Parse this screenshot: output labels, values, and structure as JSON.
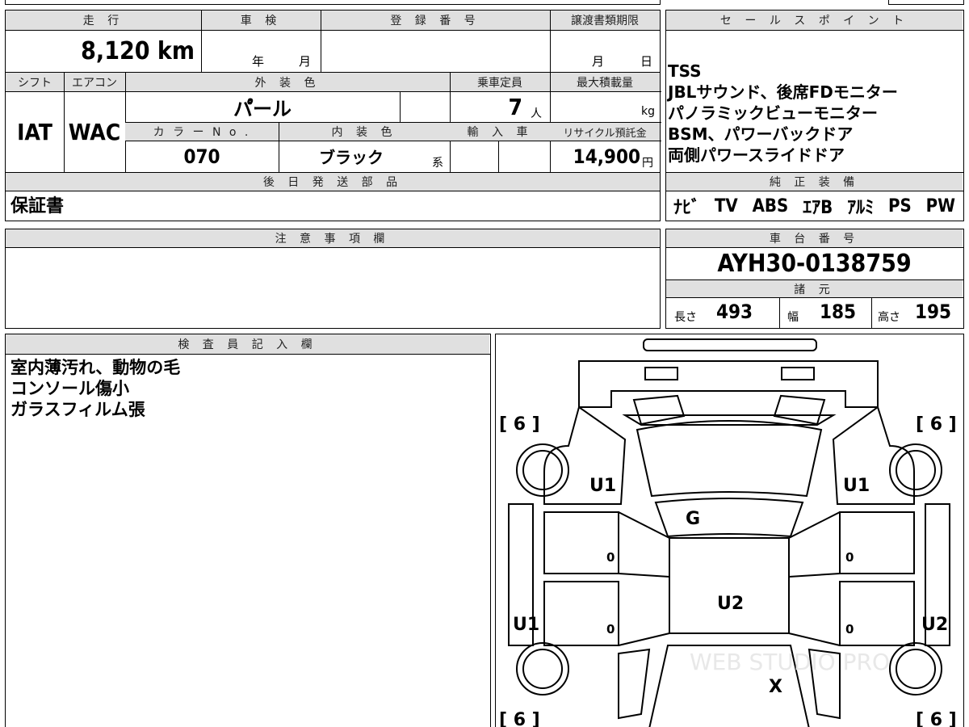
{
  "top_sheet": {
    "mileage_label": "走 行",
    "mileage_value": "8,120 km",
    "inspection_label": "車 検",
    "inspection_year_unit": "年",
    "inspection_month_unit": "月",
    "registration_label": "登 録 番 号",
    "registration_value": "",
    "transfer_deadline_label": "譲渡書類期限",
    "transfer_month_unit": "月",
    "transfer_day_unit": "日",
    "shift_label": "シフト",
    "shift_value": "IAT",
    "aircon_label": "エアコン",
    "aircon_value": "WAC",
    "exterior_color_label": "外 装 色",
    "exterior_color_value": "パ゚ール",
    "capacity_label": "乗車定員",
    "capacity_value": "7",
    "capacity_unit": "人",
    "max_load_label": "最大積載量",
    "max_load_unit": "kg",
    "color_no_label": "カ ラ ー N o .",
    "color_no_value": "070",
    "interior_color_label": "内 装 色",
    "interior_color_value": "ブラック",
    "interior_color_suffix": "系",
    "import_label": "輸 入 車",
    "recycle_label": "リサイクル預託金",
    "recycle_value": "14,900",
    "recycle_unit": "円",
    "later_parts_label": "後 日 発 送 部 品",
    "later_parts_value": "保証書"
  },
  "sales_points": {
    "label": "セ ー ル ス ポ イ ン ト",
    "lines": [
      "TSS",
      "JBLサウンド、後席FDモニター",
      "パノラミックビューモニター",
      "BSM、パワーバックドア",
      "両側パワースライドドア"
    ]
  },
  "equipment": {
    "label": "純 正 装 備",
    "items": [
      "ﾅﾋﾞ",
      "TV",
      "ABS",
      "ｴｱB",
      "ｱﾙﾐ",
      "PS",
      "PW"
    ]
  },
  "notes": {
    "label": "注 意 事 項 欄",
    "value": ""
  },
  "chassis": {
    "label": "車 台 番 号",
    "value": "AYH30-0138759"
  },
  "specs": {
    "label": "諸 元",
    "length_label": "長さ",
    "length_value": "493",
    "width_label": "幅",
    "width_value": "185",
    "height_label": "高さ",
    "height_value": "195"
  },
  "inspector": {
    "label": "検 査 員 記 入 欄",
    "lines": [
      "室内薄汚れ、動物の毛",
      "コンソール傷小",
      "ガラスフィルム張"
    ]
  },
  "diagram": {
    "tire_front_left": "[ 6 ]",
    "tire_front_right": "[ 6 ]",
    "tire_rear_left": "[ 6 ]",
    "tire_rear_right": "[ 6 ]",
    "mark_fender_left": "U1",
    "mark_fender_right": "U1",
    "mark_windshield": "G",
    "mark_roof": "U2",
    "mark_side_left": "U1",
    "mark_side_right": "U2",
    "mark_rear": "X",
    "door_fl": "0",
    "door_fr": "0",
    "door_rl": "0",
    "door_rr": "0",
    "watermark": "WEB STUDIO PRO"
  }
}
